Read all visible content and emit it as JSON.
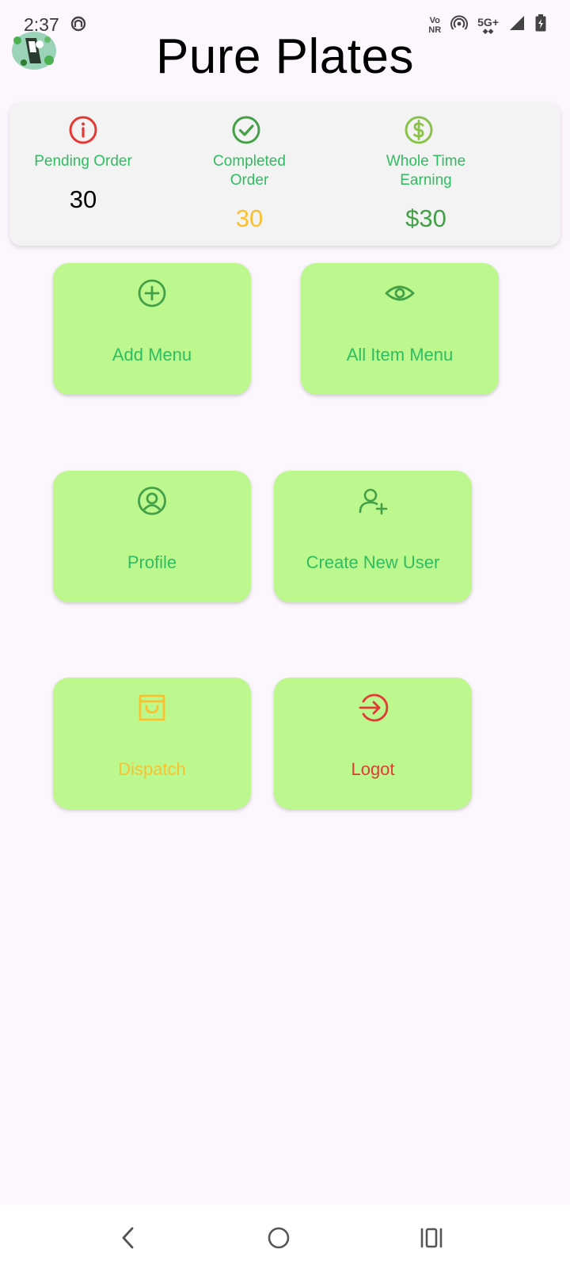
{
  "status_bar": {
    "time": "2:37",
    "volte_line1": "Vo",
    "volte_line2": "NR",
    "network": "5G+"
  },
  "app": {
    "title": "Pure Plates"
  },
  "stats": {
    "pending": {
      "label": "Pending Order",
      "value": "30",
      "icon": "info-icon",
      "icon_color": "#e53935",
      "value_color": "#000000"
    },
    "completed": {
      "label_line1": "Completed",
      "label_line2": "Order",
      "value": "30",
      "icon": "check-circle-icon",
      "icon_color": "#43a047",
      "value_color": "#fbc02d"
    },
    "earning": {
      "label_line1": "Whole Time",
      "label_line2": "Earning",
      "value": "$30",
      "icon": "dollar-circle-icon",
      "icon_color": "#8bc34a",
      "value_color": "#43a047"
    }
  },
  "tiles": [
    {
      "label": "Add Menu",
      "icon": "plus-circle-icon",
      "color": "#2ebd60"
    },
    {
      "label": "All Item Menu",
      "icon": "eye-icon",
      "color": "#2ebd60"
    },
    {
      "label": "Profile",
      "icon": "user-circle-icon",
      "color": "#2ebd60"
    },
    {
      "label": "Create New User",
      "icon": "user-plus-icon",
      "color": "#2ebd60"
    },
    {
      "label": "Dispatch",
      "icon": "shopping-bag-icon",
      "color": "#fbc02d"
    },
    {
      "label": "Logot",
      "icon": "logout-icon",
      "color": "#e53935"
    }
  ],
  "colors": {
    "background": "#fcf6fd",
    "tile_bg": "#bdf88f",
    "stats_card_bg": "#f3f3f3",
    "label_green": "#2ebd60"
  }
}
